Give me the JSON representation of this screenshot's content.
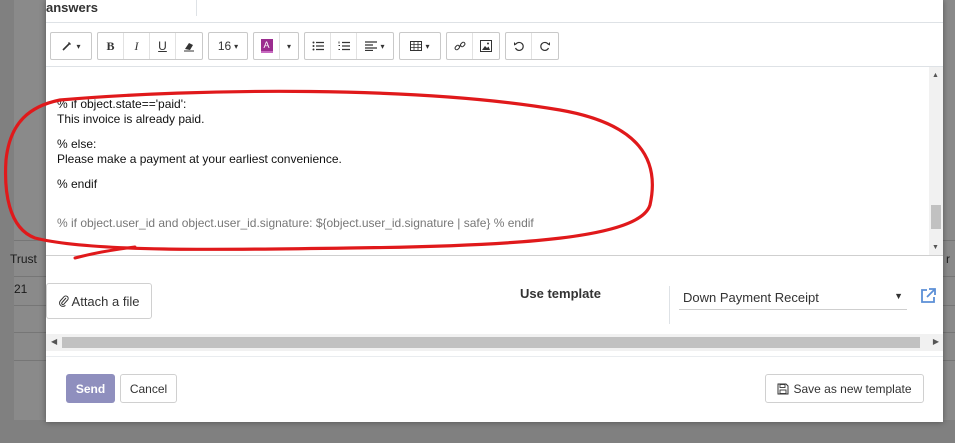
{
  "background": {
    "col_header_left": "Trust",
    "col_header_right": "r",
    "row_value": "21"
  },
  "top": {
    "label": "answers"
  },
  "toolbar": {
    "style_caret": "▾",
    "bold": "B",
    "italic": "I",
    "underline": "U",
    "font_size": "16",
    "font_color_letter": "A"
  },
  "editor": {
    "lines": [
      "% if object.state=='paid':",
      "This invoice is already paid.",
      "% else:",
      "Please make a payment at your earliest convenience.",
      "% endif",
      "% if object.user_id and object.user_id.signature: ${object.user_id.signature | safe} % endif"
    ]
  },
  "attach": {
    "label": "Attach a file"
  },
  "template": {
    "label": "Use template",
    "selected": "Down Payment Receipt"
  },
  "footer": {
    "send_label": "Send",
    "cancel_label": "Cancel",
    "save_template_label": "Save as new template"
  },
  "colors": {
    "send_bg": "#8f8fbe",
    "annotation_red": "#e0191b",
    "link_blue": "#5b8fd6"
  }
}
